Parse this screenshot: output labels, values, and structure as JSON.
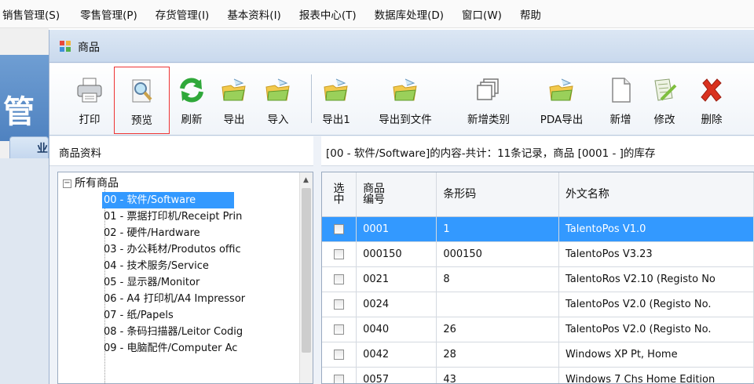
{
  "menubar": {
    "items": [
      "销售管理(S)",
      "零售管理(P)",
      "存货管理(I)",
      "基本资料(I)",
      "报表中心(T)",
      "数据库处理(D)",
      "窗口(W)",
      "帮助"
    ]
  },
  "background_app": {
    "banner_char": "管",
    "tab_char": "业"
  },
  "window": {
    "title": "商品"
  },
  "toolbar": {
    "buttons": [
      {
        "label": "打印",
        "icon": "printer-icon"
      },
      {
        "label": "预览",
        "icon": "preview-magnifier-icon"
      },
      {
        "label": "刷新",
        "icon": "refresh-icon"
      },
      {
        "label": "导出",
        "icon": "export-icon"
      },
      {
        "label": "导入",
        "icon": "import-icon"
      },
      {
        "label": "导出1",
        "icon": "export1-icon"
      },
      {
        "label": "导出到文件",
        "icon": "export-file-icon"
      },
      {
        "label": "新增类别",
        "icon": "new-category-icon"
      },
      {
        "label": "PDA导出",
        "icon": "pda-export-icon"
      },
      {
        "label": "新增",
        "icon": "new-document-icon"
      },
      {
        "label": "修改",
        "icon": "edit-icon"
      },
      {
        "label": "删除",
        "icon": "delete-icon"
      }
    ]
  },
  "left_panel": {
    "header": "商品资料",
    "root": "所有商品",
    "items": [
      "00 - 软件/Software",
      "01 - 票据打印机/Receipt Prin",
      "02 - 硬件/Hardware",
      "03 - 办公耗材/Produtos offic",
      "04 - 技术服务/Service",
      "05 - 显示器/Monitor",
      "06 - A4 打印机/A4 Impressor",
      "07 - 纸/Papels",
      "08 - 条码扫描器/Leitor Codig",
      "09 - 电脑配件/Computer Ac"
    ]
  },
  "right_panel": {
    "header": "[00 - 软件/Software]的内容-共计：11条记录，商品 [0001 - ]的库存",
    "columns": [
      "选中",
      "商品编号",
      "条形码",
      "外文名称"
    ],
    "rows": [
      [
        "0001",
        "1",
        "TalentoPos V1.0"
      ],
      [
        "000150",
        "000150",
        "TalentoPos V3.23"
      ],
      [
        "0021",
        "8",
        "TalentoRos V2.10 (Registo No"
      ],
      [
        "0024",
        "",
        "TalentoPos V2.0 (Registo No."
      ],
      [
        "0040",
        "26",
        "TalentoPos V2.0 (Registo No."
      ],
      [
        "0042",
        "28",
        "Windows XP Pt, Home"
      ],
      [
        "0057",
        "43",
        "Windows 7 Chs Home Edition"
      ]
    ]
  },
  "colors": {
    "selection": "#3399ff",
    "highlight_border": "#ee3333"
  }
}
